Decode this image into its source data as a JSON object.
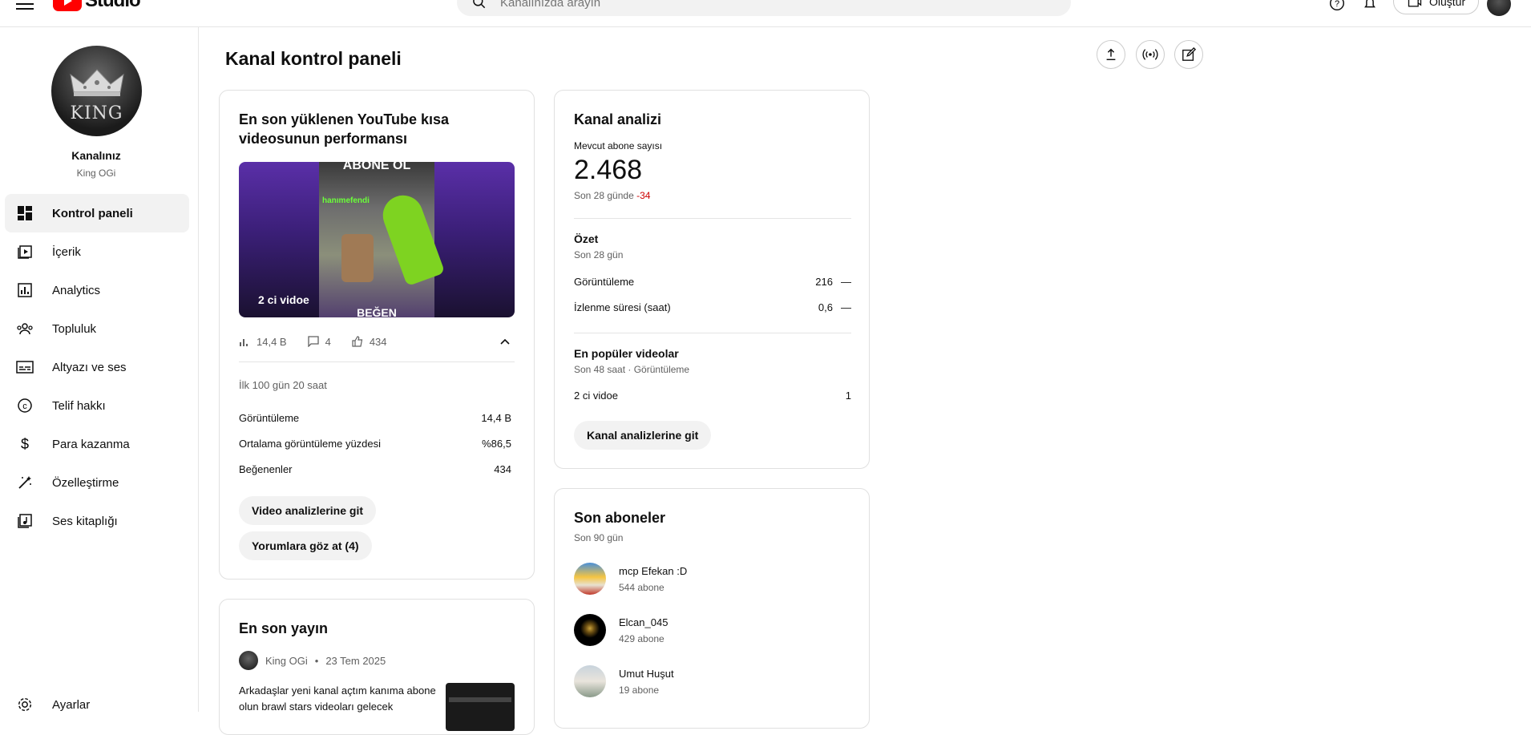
{
  "topbar": {
    "logo_text": "Studio",
    "search_placeholder": "Kanalınızda arayın",
    "create_label": "Oluştur"
  },
  "sidebar": {
    "channel_title": "Kanalınız",
    "channel_name": "King OGi",
    "avatar_text": "KING",
    "items": [
      {
        "label": "Kontrol paneli",
        "icon": "dashboard-icon"
      },
      {
        "label": "İçerik",
        "icon": "content-icon"
      },
      {
        "label": "Analytics",
        "icon": "analytics-icon"
      },
      {
        "label": "Topluluk",
        "icon": "community-icon"
      },
      {
        "label": "Altyazı ve ses",
        "icon": "subtitles-icon"
      },
      {
        "label": "Telif hakkı",
        "icon": "copyright-icon"
      },
      {
        "label": "Para kazanma",
        "icon": "monetization-icon"
      },
      {
        "label": "Özelleştirme",
        "icon": "customization-icon"
      },
      {
        "label": "Ses kitaplığı",
        "icon": "audio-library-icon"
      }
    ],
    "settings_label": "Ayarlar"
  },
  "main": {
    "page_title": "Kanal kontrol paneli"
  },
  "shorts_card": {
    "title": "En son yüklenen YouTube kısa videosunun performansı",
    "thumb_title": "2 ci vidoe",
    "thumb_top_text": "ABONE OL",
    "thumb_tag": "hanımefendi",
    "thumb_bottom_text": "BEĞEN",
    "views_short": "14,4 B",
    "comments_short": "4",
    "likes_short": "434",
    "period": "İlk 100 gün 20 saat",
    "stats": [
      {
        "label": "Görüntüleme",
        "value": "14,4 B"
      },
      {
        "label": "Ortalama görüntüleme yüzdesi",
        "value": "%86,5"
      },
      {
        "label": "Beğenenler",
        "value": "434"
      }
    ],
    "btn_analytics": "Video analizlerine git",
    "btn_comments": "Yorumlara göz at (4)"
  },
  "stream_card": {
    "title": "En son yayın",
    "author": "King OGi",
    "separator": "•",
    "date": "23 Tem 2025",
    "text": "Arkadaşlar  yeni kanal açtım kanıma abone olun brawl stars  videoları  gelecek"
  },
  "analytics_card": {
    "title": "Kanal analizi",
    "subs_label": "Mevcut abone sayısı",
    "subs_value": "2.468",
    "subs_change_prefix": "Son 28 günde",
    "subs_change": "-34",
    "summary_title": "Özet",
    "summary_period": "Son 28 gün",
    "summary_rows": [
      {
        "label": "Görüntüleme",
        "value": "216",
        "trend": "—"
      },
      {
        "label": "İzlenme süresi (saat)",
        "value": "0,6",
        "trend": "—"
      }
    ],
    "top_title": "En popüler videolar",
    "top_period": "Son 48 saat · Görüntüleme",
    "top_rows": [
      {
        "label": "2 ci vidoe",
        "value": "1"
      }
    ],
    "btn": "Kanal analizlerine git"
  },
  "subscribers_card": {
    "title": "Son aboneler",
    "period": "Son 90 gün",
    "items": [
      {
        "name": "mcp Efekan :D",
        "count": "544 abone"
      },
      {
        "name": "Elcan_045",
        "count": "429 abone"
      },
      {
        "name": "Umut Huşut",
        "count": "19 abone"
      }
    ]
  },
  "colors": {
    "accent_red": "#ff0000",
    "negative": "#cc0000"
  }
}
